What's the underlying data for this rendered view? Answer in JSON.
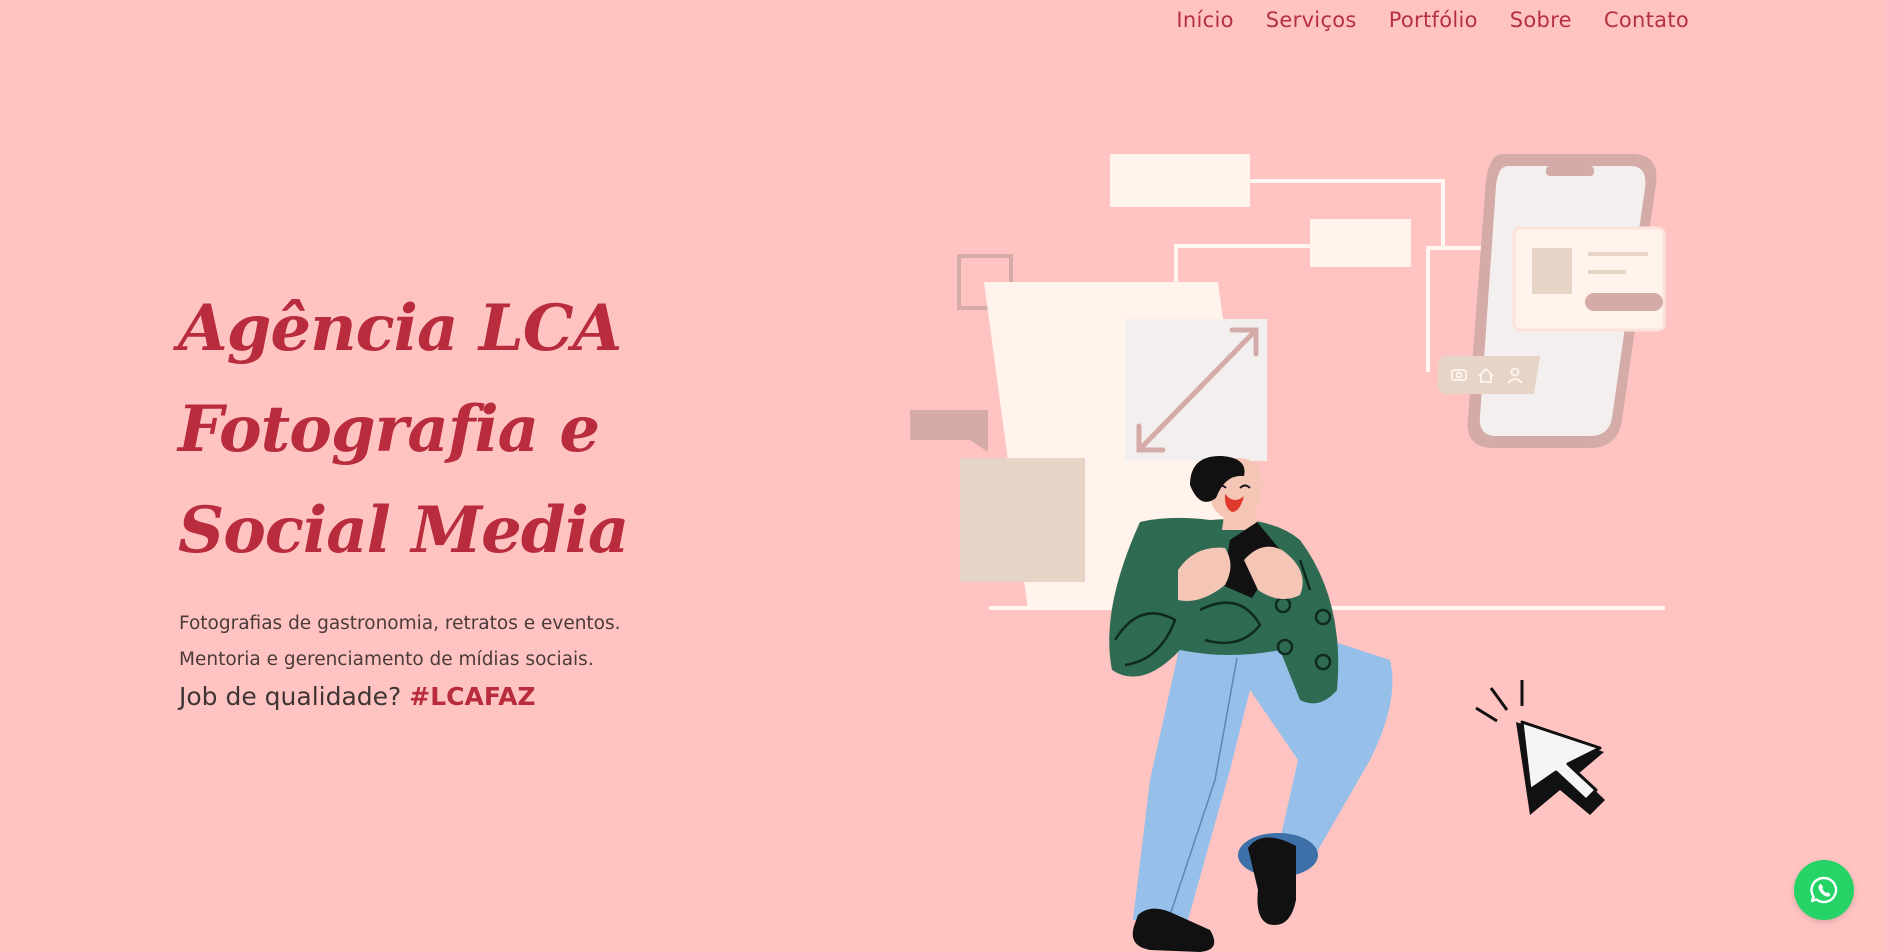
{
  "nav": {
    "items": [
      {
        "label": "Início"
      },
      {
        "label": "Serviços"
      },
      {
        "label": "Portfólio"
      },
      {
        "label": "Sobre"
      },
      {
        "label": "Contato"
      }
    ]
  },
  "hero": {
    "title_lines": [
      "Agência LCA",
      "Fotografia e",
      "Social Media"
    ],
    "description_lines": [
      "Fotografias de gastronomia, retratos e eventos.",
      "Mentoria e gerenciamento de mídias sociais."
    ],
    "tagline_prefix": "Job de qualidade?",
    "tagline_hashtag": "#LCAFAZ"
  },
  "icons": {
    "whatsapp": "whatsapp-icon",
    "cursor": "cursor-arrow-icon",
    "camera": "camera-icon",
    "home": "home-icon",
    "user": "user-icon",
    "expand": "expand-arrows-icon"
  },
  "colors": {
    "background": "#ffc4c2",
    "accent": "#b82c3d",
    "whatsapp": "#25d366"
  }
}
